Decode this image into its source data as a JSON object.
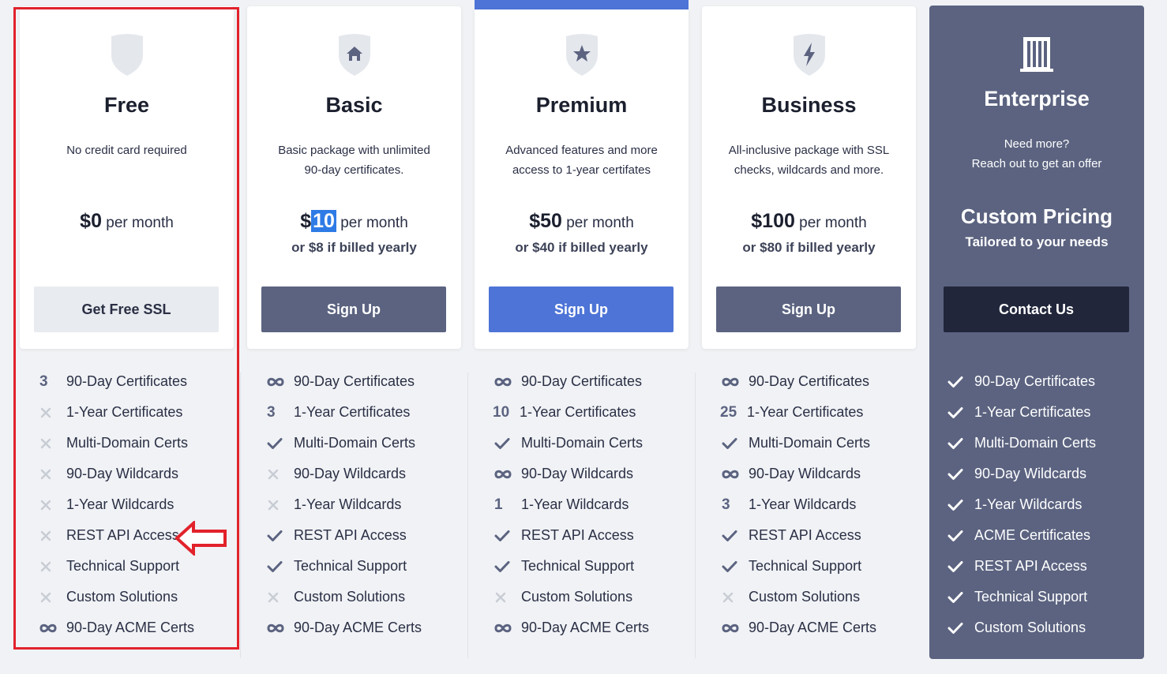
{
  "plans": [
    {
      "name": "Free",
      "desc1": "No credit card required",
      "desc2": "",
      "price": "$0",
      "price_suffix": "per month",
      "yearly": "",
      "button": "Get Free SSL",
      "features": [
        {
          "icon": "count",
          "value": "3",
          "label": "90-Day Certificates"
        },
        {
          "icon": "cross",
          "label": "1-Year Certificates"
        },
        {
          "icon": "cross",
          "label": "Multi-Domain Certs"
        },
        {
          "icon": "cross",
          "label": "90-Day Wildcards"
        },
        {
          "icon": "cross",
          "label": "1-Year Wildcards"
        },
        {
          "icon": "cross",
          "label": "REST API Access"
        },
        {
          "icon": "cross",
          "label": "Technical Support"
        },
        {
          "icon": "cross",
          "label": "Custom Solutions"
        },
        {
          "icon": "infinity",
          "label": "90-Day ACME Certs"
        }
      ]
    },
    {
      "name": "Basic",
      "desc1": "Basic package with unlimited",
      "desc2": "90-day certificates.",
      "price_prefix": "$",
      "price_selected": "10",
      "price_suffix": "per month",
      "yearly": "or $8 if billed yearly",
      "button": "Sign Up",
      "features": [
        {
          "icon": "infinity",
          "label": "90-Day Certificates"
        },
        {
          "icon": "count",
          "value": "3",
          "label": "1-Year Certificates"
        },
        {
          "icon": "check",
          "label": "Multi-Domain Certs"
        },
        {
          "icon": "cross",
          "label": "90-Day Wildcards"
        },
        {
          "icon": "cross",
          "label": "1-Year Wildcards"
        },
        {
          "icon": "check",
          "label": "REST API Access"
        },
        {
          "icon": "check",
          "label": "Technical Support"
        },
        {
          "icon": "cross",
          "label": "Custom Solutions"
        },
        {
          "icon": "infinity",
          "label": "90-Day ACME Certs"
        }
      ]
    },
    {
      "name": "Premium",
      "desc1": "Advanced features and more",
      "desc2": "access to 1-year certifates",
      "price": "$50",
      "price_suffix": "per month",
      "yearly": "or $40 if billed yearly",
      "button": "Sign Up",
      "features": [
        {
          "icon": "infinity",
          "label": "90-Day Certificates"
        },
        {
          "icon": "count",
          "value": "10",
          "label": "1-Year Certificates"
        },
        {
          "icon": "check",
          "label": "Multi-Domain Certs"
        },
        {
          "icon": "infinity",
          "label": "90-Day Wildcards"
        },
        {
          "icon": "count",
          "value": "1",
          "label": "1-Year Wildcards"
        },
        {
          "icon": "check",
          "label": "REST API Access"
        },
        {
          "icon": "check",
          "label": "Technical Support"
        },
        {
          "icon": "cross",
          "label": "Custom Solutions"
        },
        {
          "icon": "infinity",
          "label": "90-Day ACME Certs"
        }
      ]
    },
    {
      "name": "Business",
      "desc1": "All-inclusive package with SSL",
      "desc2": "checks, wildcards and more.",
      "price": "$100",
      "price_suffix": "per month",
      "yearly": "or $80 if billed yearly",
      "button": "Sign Up",
      "features": [
        {
          "icon": "infinity",
          "label": "90-Day Certificates"
        },
        {
          "icon": "count",
          "value": "25",
          "label": "1-Year Certificates"
        },
        {
          "icon": "check",
          "label": "Multi-Domain Certs"
        },
        {
          "icon": "infinity",
          "label": "90-Day Wildcards"
        },
        {
          "icon": "count",
          "value": "3",
          "label": "1-Year Wildcards"
        },
        {
          "icon": "check",
          "label": "REST API Access"
        },
        {
          "icon": "check",
          "label": "Technical Support"
        },
        {
          "icon": "cross",
          "label": "Custom Solutions"
        },
        {
          "icon": "infinity",
          "label": "90-Day ACME Certs"
        }
      ]
    },
    {
      "name": "Enterprise",
      "desc1": "Need more?",
      "desc2": "Reach out to get an offer",
      "price": "Custom Pricing",
      "yearly": "Tailored to your needs",
      "button": "Contact Us",
      "features": [
        {
          "icon": "check",
          "label": "90-Day Certificates"
        },
        {
          "icon": "check",
          "label": "1-Year Certificates"
        },
        {
          "icon": "check",
          "label": "Multi-Domain Certs"
        },
        {
          "icon": "check",
          "label": "90-Day Wildcards"
        },
        {
          "icon": "check",
          "label": "1-Year Wildcards"
        },
        {
          "icon": "check",
          "label": "ACME Certificates"
        },
        {
          "icon": "check",
          "label": "REST API Access"
        },
        {
          "icon": "check",
          "label": "Technical Support"
        },
        {
          "icon": "check",
          "label": "Custom Solutions"
        }
      ]
    }
  ],
  "icons": {
    "free": "shield-blank-icon",
    "basic": "shield-home-icon",
    "premium": "shield-star-icon",
    "business": "shield-bolt-icon",
    "enterprise": "building-icon"
  },
  "colors": {
    "accent": "#4d74d6",
    "slate": "#5b6380",
    "dark": "#21263b",
    "annotation": "#e2222b"
  }
}
